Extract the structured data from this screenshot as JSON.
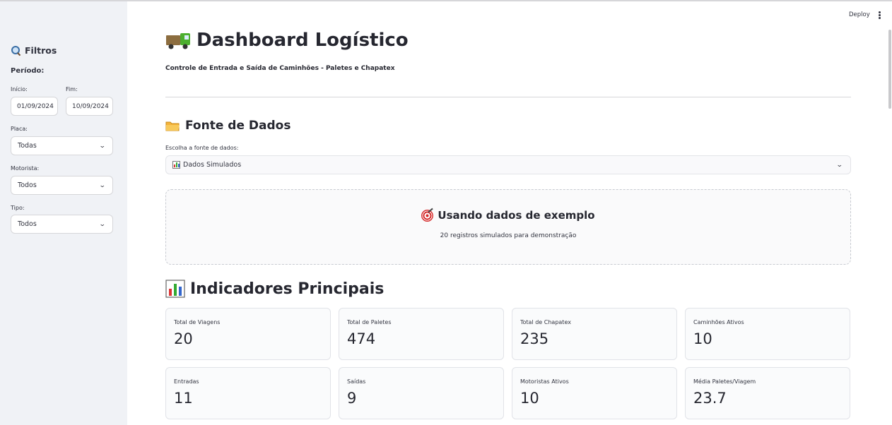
{
  "header": {
    "deploy_label": "Deploy"
  },
  "sidebar": {
    "title": "Filtros",
    "period_label": "Período:",
    "start_label": "Início:",
    "start_value": "01/09/2024",
    "end_label": "Fim:",
    "end_value": "10/09/2024",
    "plate_label": "Placa:",
    "plate_value": "Todas",
    "driver_label": "Motorista:",
    "driver_value": "Todos",
    "type_label": "Tipo:",
    "type_value": "Todos"
  },
  "main": {
    "title": "Dashboard Logístico",
    "subtitle": "Controle de Entrada e Saída de Caminhões - Paletes e Chapatex",
    "data_source": {
      "heading": "Fonte de Dados",
      "select_label": "Escolha a fonte de dados:",
      "select_value": "Dados Simulados"
    },
    "notice": {
      "title": "Usando dados de exemplo",
      "text": "20 registros simulados para demonstração"
    },
    "kpis": {
      "heading": "Indicadores Principais",
      "cards": [
        {
          "label": "Total de Viagens",
          "value": "20"
        },
        {
          "label": "Total de Paletes",
          "value": "474"
        },
        {
          "label": "Total de Chapatex",
          "value": "235"
        },
        {
          "label": "Caminhões Ativos",
          "value": "10"
        },
        {
          "label": "Entradas",
          "value": "11"
        },
        {
          "label": "Saídas",
          "value": "9"
        },
        {
          "label": "Motoristas Ativos",
          "value": "10"
        },
        {
          "label": "Média Paletes/Viagem",
          "value": "23.7"
        }
      ]
    }
  },
  "icons": {
    "title": "truck-icon",
    "filters": "magnifier-icon",
    "data_source": "folder-icon",
    "notice": "target-icon",
    "kpis": "bar-chart-icon"
  },
  "colors": {
    "sidebar_bg": "#f0f2f6",
    "text": "#31333f",
    "truck_green": "#4caf2e",
    "target_red": "#d52b2b"
  }
}
